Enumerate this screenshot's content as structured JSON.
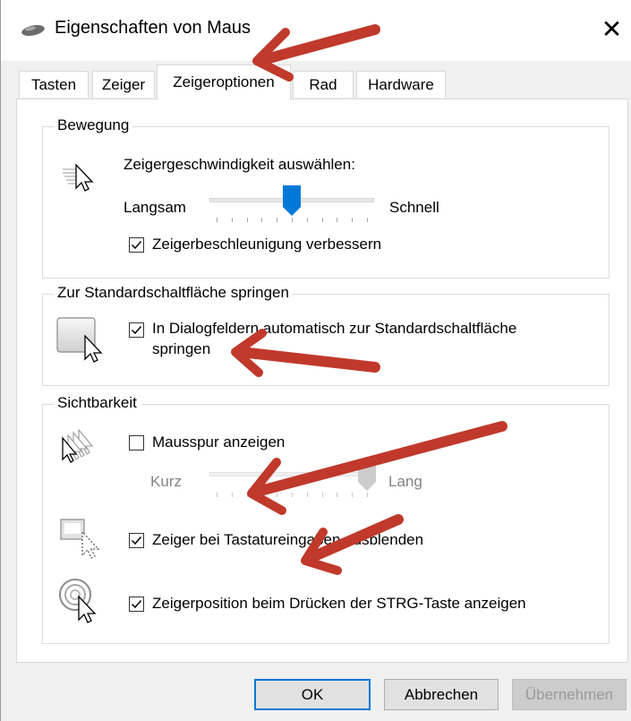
{
  "window": {
    "title": "Eigenschaften von Maus",
    "close_glyph": "✕"
  },
  "tabs": [
    {
      "label": "Tasten",
      "active": false
    },
    {
      "label": "Zeiger",
      "active": false
    },
    {
      "label": "Zeigeroptionen",
      "active": true
    },
    {
      "label": "Rad",
      "active": false
    },
    {
      "label": "Hardware",
      "active": false
    }
  ],
  "motion": {
    "group_label": "Bewegung",
    "speed_label": "Zeigergeschwindigkeit auswählen:",
    "slow_label": "Langsam",
    "fast_label": "Schnell",
    "speed_value": 0.5,
    "acceleration_label": "Zeigerbeschleunigung verbessern",
    "acceleration_checked": true
  },
  "snap": {
    "group_label": "Zur Standardschaltfläche springen",
    "checkbox_label_line1": "In Dialogfeldern automatisch zur Standardschaltfläche",
    "checkbox_label_line2": "springen",
    "checked": true
  },
  "visibility": {
    "group_label": "Sichtbarkeit",
    "trails_label": "Mausspur anzeigen",
    "trails_checked": false,
    "short_label": "Kurz",
    "long_label": "Lang",
    "trail_value": 1.0,
    "hide_typing_label": "Zeiger bei Tastatureingaben ausblenden",
    "hide_typing_checked": true,
    "ctrl_location_label": "Zeigerposition beim Drücken der STRG-Taste anzeigen",
    "ctrl_location_checked": true
  },
  "buttons": {
    "ok": "OK",
    "cancel": "Abbrechen",
    "apply": "Übernehmen"
  },
  "colors": {
    "accent": "#0078d7",
    "annotation_arrow": "#c0392b"
  },
  "icons": {
    "window": "mouse-icon",
    "speed": "pointer-speed-icon",
    "snap": "snap-to-default-icon",
    "trails": "pointer-trails-icon",
    "hide": "hide-pointer-icon",
    "locate": "locate-pointer-icon"
  }
}
